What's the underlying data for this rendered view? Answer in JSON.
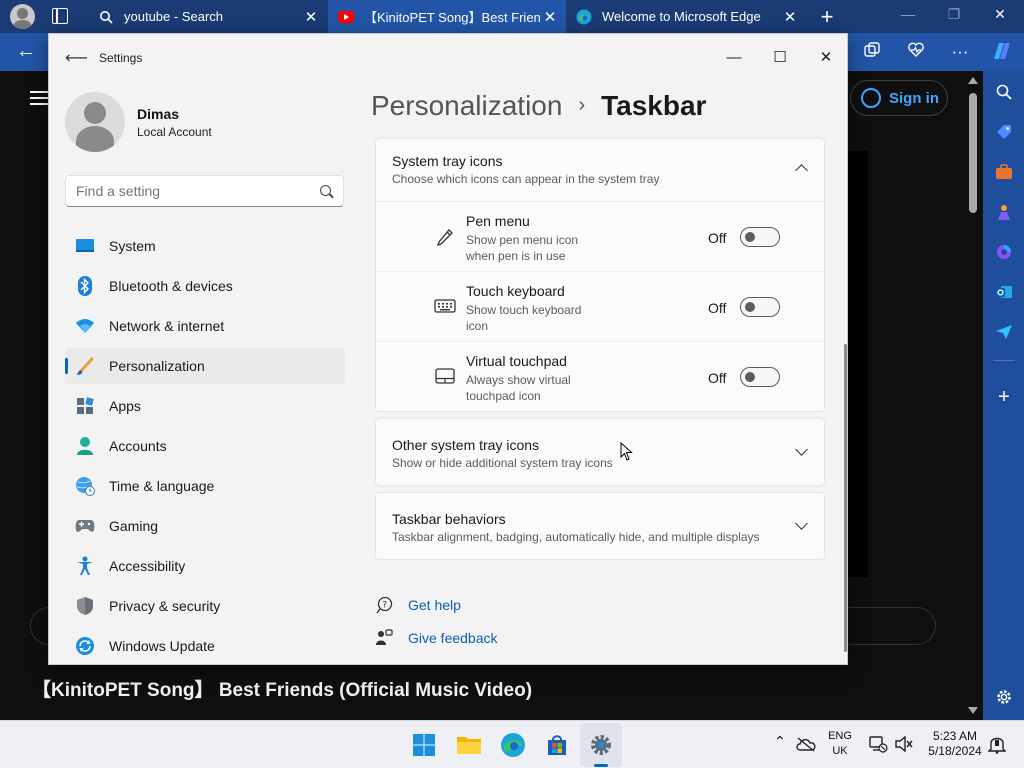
{
  "browser": {
    "tabs": [
      {
        "title": "youtube - Search",
        "icon": "search-icon"
      },
      {
        "title": "【KinitoPET Song】Best Friends (C",
        "icon": "youtube-icon"
      },
      {
        "title": "Welcome to Microsoft Edge",
        "icon": "edge-icon"
      }
    ],
    "active_tab": 1
  },
  "youtube": {
    "sign_in": "Sign in",
    "video_title": "【KinitoPET Song】 Best Friends (Official Music Video)"
  },
  "settings": {
    "app_title": "Settings",
    "user": {
      "name": "Dimas",
      "type": "Local Account"
    },
    "search_placeholder": "Find a setting",
    "nav": [
      {
        "label": "System",
        "icon": "system-icon"
      },
      {
        "label": "Bluetooth & devices",
        "icon": "bluetooth-icon"
      },
      {
        "label": "Network & internet",
        "icon": "wifi-icon"
      },
      {
        "label": "Personalization",
        "icon": "brush-icon",
        "selected": true
      },
      {
        "label": "Apps",
        "icon": "apps-icon"
      },
      {
        "label": "Accounts",
        "icon": "accounts-icon"
      },
      {
        "label": "Time & language",
        "icon": "globe-clock-icon"
      },
      {
        "label": "Gaming",
        "icon": "gamepad-icon"
      },
      {
        "label": "Accessibility",
        "icon": "accessibility-icon"
      },
      {
        "label": "Privacy & security",
        "icon": "shield-icon"
      },
      {
        "label": "Windows Update",
        "icon": "update-icon"
      }
    ],
    "breadcrumb": {
      "parent": "Personalization",
      "current": "Taskbar"
    },
    "tray_section": {
      "title": "System tray icons",
      "desc": "Choose which icons can appear in the system tray",
      "items": [
        {
          "title": "Pen menu",
          "desc": "Show pen menu icon when pen is in use",
          "state": "Off",
          "icon": "pen-icon"
        },
        {
          "title": "Touch keyboard",
          "desc": "Show touch keyboard icon",
          "state": "Off",
          "icon": "keyboard-icon"
        },
        {
          "title": "Virtual touchpad",
          "desc": "Always show virtual touchpad icon",
          "state": "Off",
          "icon": "touchpad-icon"
        }
      ]
    },
    "other_tray": {
      "title": "Other system tray icons",
      "desc": "Show or hide additional system tray icons"
    },
    "behaviors": {
      "title": "Taskbar behaviors",
      "desc": "Taskbar alignment, badging, automatically hide, and multiple displays"
    },
    "links": {
      "help": "Get help",
      "feedback": "Give feedback"
    }
  },
  "taskbar": {
    "language": "ENG",
    "region": "UK",
    "time": "5:23 AM",
    "date": "5/18/2024"
  },
  "colors": {
    "accent": "#0067c0",
    "edge_chrome": "#2255a7",
    "link": "#0e5fb5"
  }
}
